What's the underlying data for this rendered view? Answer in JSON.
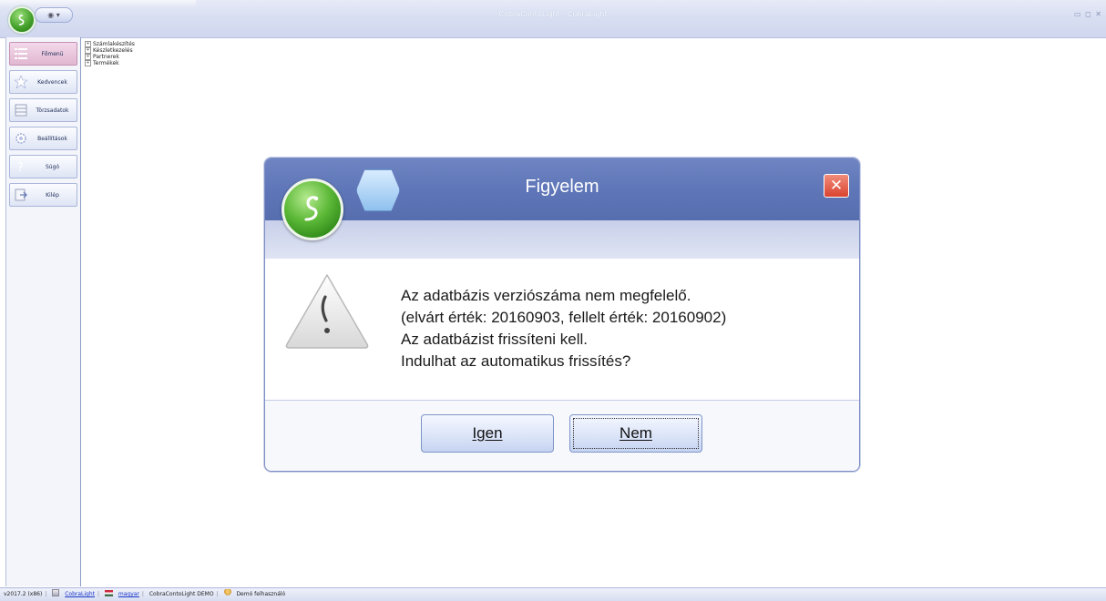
{
  "window": {
    "title": "CobraContoLight - CobraLight",
    "quick_access": "◉ ▾",
    "controls": "▭ ◻ ✕"
  },
  "nav": {
    "items": [
      {
        "label": "Főmenü",
        "icon": "list-icon",
        "active": true
      },
      {
        "label": "Kedvencek",
        "icon": "star-icon",
        "active": false
      },
      {
        "label": "Törzsadatok",
        "icon": "table-icon",
        "active": false
      },
      {
        "label": "Beállítások",
        "icon": "gear-icon",
        "active": false
      },
      {
        "label": "Súgó",
        "icon": "help-icon",
        "active": false
      },
      {
        "label": "Kilép",
        "icon": "exit-icon",
        "active": false
      }
    ]
  },
  "tree": {
    "items": [
      {
        "label": "Számlakészítés"
      },
      {
        "label": "Készletkezelés"
      },
      {
        "label": "Partnerek"
      },
      {
        "label": "Termékek"
      }
    ]
  },
  "dialog": {
    "title": "Figyelem",
    "close": "✕",
    "message_lines": [
      "Az adatbázis verziószáma nem megfelelő.",
      "(elvárt érték: 20160903, fellelt érték: 20160902)",
      "Az adatbázist frissíteni kell.",
      "Indulhat az automatikus frissítés?"
    ],
    "buttons": {
      "yes": "Igen",
      "no": "Nem"
    }
  },
  "status": {
    "version": "v2017.2 (x86)",
    "product_link": "CobraLight",
    "language": "magyar",
    "database": "CobraContoLight DEMO",
    "user": "Demó felhasználó"
  },
  "colors": {
    "dialog_header": "#5f76b8",
    "accent_green": "#4caf2f",
    "close_red": "#d9432f"
  }
}
